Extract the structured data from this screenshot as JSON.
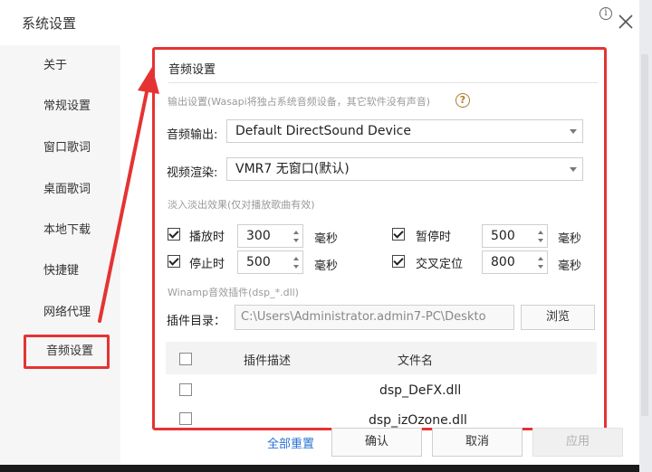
{
  "window": {
    "title": "系统设置"
  },
  "sidebar": {
    "items": [
      {
        "label": "关于"
      },
      {
        "label": "常规设置"
      },
      {
        "label": "窗口歌词"
      },
      {
        "label": "桌面歌词"
      },
      {
        "label": "本地下载"
      },
      {
        "label": "快捷键"
      },
      {
        "label": "网络代理"
      },
      {
        "label": "音频设置",
        "active": true
      }
    ]
  },
  "panel": {
    "title": "音频设置",
    "wasapi_hint": "输出设置(Wasapi将独占系统音频设备，其它软件没有声音)",
    "audio_output": {
      "label": "音频输出:",
      "value": "Default DirectSound Device"
    },
    "video_render": {
      "label": "视频渲染:",
      "value": "VMR7 无窗口(默认)"
    },
    "fade_hint": "淡入淡出效果(仅对播放歌曲有效)",
    "fade": [
      {
        "label": "播放时",
        "value": "300",
        "unit": "毫秒",
        "checked": true
      },
      {
        "label": "暂停时",
        "value": "500",
        "unit": "毫秒",
        "checked": true
      },
      {
        "label": "停止时",
        "value": "500",
        "unit": "毫秒",
        "checked": true
      },
      {
        "label": "交叉定位",
        "value": "800",
        "unit": "毫秒",
        "checked": true
      }
    ],
    "winamp_hint": "Winamp音效插件(dsp_*.dll)",
    "plugin_dir": {
      "label": "插件目录：",
      "value": "C:\\Users\\Administrator.admin7-PC\\Deskto",
      "browse": "浏览"
    },
    "table": {
      "headers": [
        "插件描述",
        "文件名"
      ],
      "rows": [
        {
          "file": "dsp_DeFX.dll"
        },
        {
          "file": "dsp_izOzone.dll"
        }
      ]
    }
  },
  "footer": {
    "reset": "全部重置",
    "ok": "确认",
    "cancel": "取消",
    "apply": "应用"
  },
  "colors": {
    "annotation": "#e53333",
    "link": "#2a72d4"
  },
  "icons": {
    "info": "info-icon",
    "close": "close-icon",
    "help": "help-icon"
  }
}
